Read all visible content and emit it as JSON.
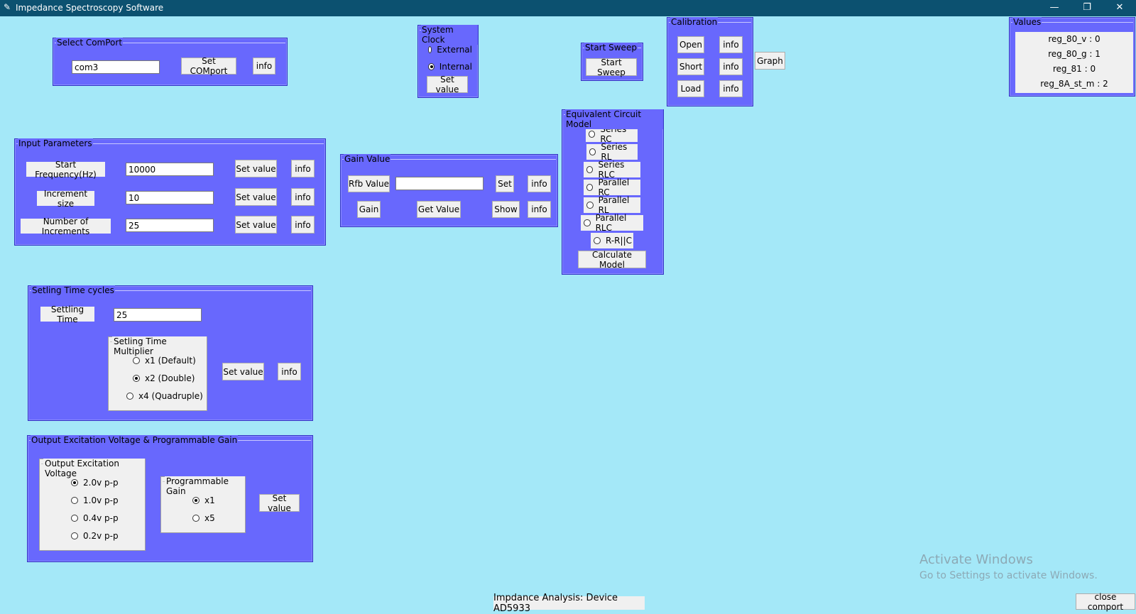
{
  "window": {
    "title": "Impedance Spectroscopy Software",
    "icon": "feather-icon",
    "min": "—",
    "max": "❐",
    "close": "✕"
  },
  "comport": {
    "legend": "Select ComPort",
    "value": "com3",
    "set_label": "Set COMport",
    "info_label": "info"
  },
  "clock": {
    "legend": "System Clock",
    "options": [
      "External",
      "Internal"
    ],
    "selected": "Internal",
    "set_label": "Set value"
  },
  "sweep": {
    "legend": "Start Sweep",
    "button": "Start Sweep"
  },
  "calibration": {
    "legend": "Calibration",
    "open": "Open",
    "short": "Short",
    "load": "Load",
    "info": "info"
  },
  "graph_label": "Graph",
  "values_panel": {
    "legend": "Values",
    "rows": [
      "reg_80_v : 0",
      "reg_80_g : 1",
      "reg_81 : 0",
      "reg_8A_st_m : 2"
    ]
  },
  "input_params": {
    "legend": "Input Parameters",
    "start_label": "Start Frequency(Hz)",
    "start_value": "10000",
    "inc_label": "Increment size",
    "inc_value": "10",
    "num_label": "Number of Increments",
    "num_value": "25",
    "set_label": "Set value",
    "info_label": "info"
  },
  "gain": {
    "legend": "Gain Value",
    "rfb_label": "Rfb Value",
    "rfb_value": "",
    "set_label": "Set",
    "info_label": "info",
    "gain_label": "Gain",
    "get_label": "Get Value",
    "show_label": "Show"
  },
  "circuit": {
    "legend": "Equivalent Circuit Model",
    "models": [
      "Series RC",
      "Series RL",
      "Series RLC",
      "Parallel RC",
      "Parallel RL",
      "Parallel RLC",
      "R-R||C"
    ],
    "calc_label": "Calculate Model"
  },
  "settling": {
    "legend": "Setling Time cycles",
    "time_label": "Settling Time",
    "time_value": "25",
    "mult_legend": "Setling Time Multiplier",
    "mult_options": [
      "x1 (Default)",
      "x2 (Double)",
      "x4 (Quadruple)"
    ],
    "mult_selected": "x2 (Double)",
    "set_label": "Set value",
    "info_label": "info"
  },
  "output": {
    "legend": "Output Excitation Voltage & Programmable Gain",
    "volt_legend": "Output Excitation Voltage",
    "volt_options": [
      "2.0v p-p",
      "1.0v p-p",
      "0.4v p-p",
      "0.2v p-p"
    ],
    "volt_selected": "2.0v p-p",
    "pga_legend": "Programmable Gain",
    "pga_options": [
      "x1",
      "x5"
    ],
    "pga_selected": "x1",
    "set_label": "Set value"
  },
  "watermark": {
    "line1": "Activate Windows",
    "line2": "Go to Settings to activate Windows."
  },
  "status_text": "Impdance Analysis: Device AD5933",
  "close_comport_label": "close comport"
}
